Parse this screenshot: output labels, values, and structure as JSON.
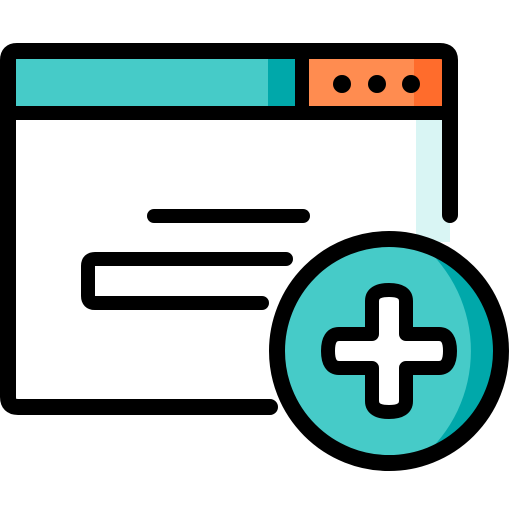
{
  "icon": {
    "name": "add-browser-window-icon",
    "window_menu_dots": 3,
    "colors": {
      "outline": "#000000",
      "window_body": "#ffffff",
      "window_shadow": "#d9f5f4",
      "title_bar": "#46cbc8",
      "title_bar_shadow": "#00a8aa",
      "menu_block": "#ff8c50",
      "menu_block_shadow": "#ff6c2c",
      "plus_badge": "#46cbc8",
      "plus_badge_shadow": "#00a8aa",
      "plus_sign": "#ffffff"
    }
  }
}
